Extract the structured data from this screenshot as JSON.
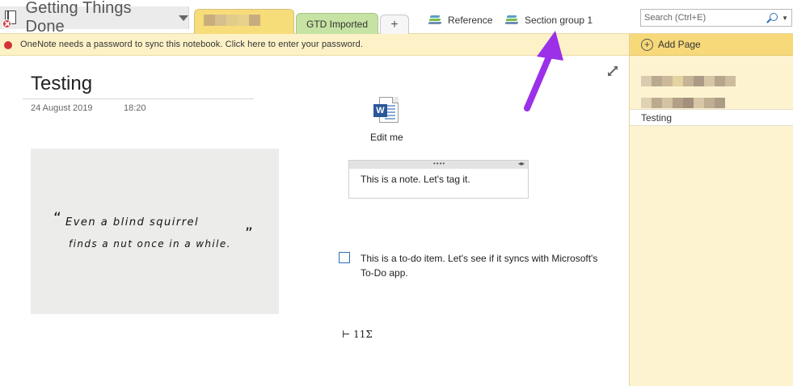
{
  "notebook": {
    "title": "Getting Things Done"
  },
  "tabs": {
    "gtd_imported": "GTD Imported",
    "add": "+"
  },
  "section_groups": [
    {
      "label": "Reference"
    },
    {
      "label": "Section group 1"
    }
  ],
  "search": {
    "placeholder": "Search (Ctrl+E)"
  },
  "notification": {
    "text": "OneNote needs a password to sync this notebook. Click here to enter your password."
  },
  "page_pane": {
    "add_page": "Add Page",
    "pages": [
      {
        "title": "Testing"
      }
    ]
  },
  "page": {
    "title": "Testing",
    "date": "24 August 2019",
    "time": "18:20",
    "image_quote_line1": "Even a blind squirrel",
    "image_quote_line2": "finds a nut once in a while.",
    "attachment_label": "Edit me",
    "note_text": "This is a note. Let's tag it.",
    "todo_text": "This is a to-do item. Let's see if it syncs with Microsoft's To-Do app.",
    "formula_text": "⊢ 11Σ"
  },
  "colors": {
    "accent_tab": "#f7dc7a",
    "gtd_tab": "#c6e3a3",
    "annotation_arrow": "#9b30e8"
  }
}
